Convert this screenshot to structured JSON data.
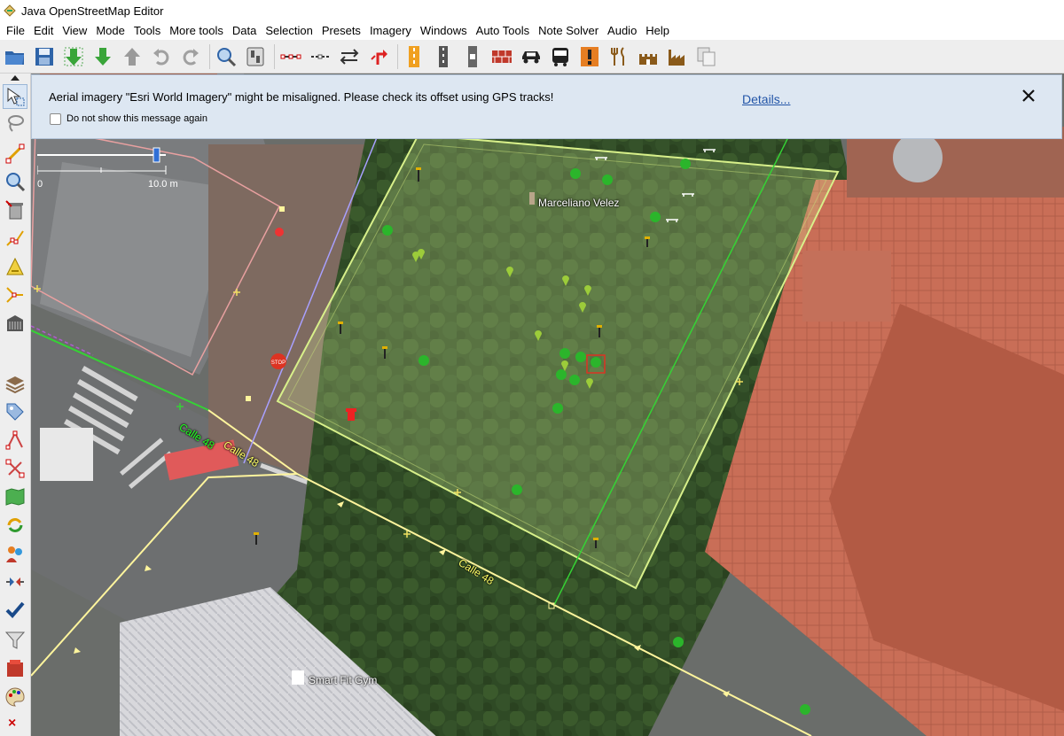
{
  "window": {
    "title": "Java OpenStreetMap Editor"
  },
  "menu": [
    "File",
    "Edit",
    "View",
    "Mode",
    "Tools",
    "More tools",
    "Data",
    "Selection",
    "Presets",
    "Imagery",
    "Windows",
    "Auto Tools",
    "Note Solver",
    "Audio",
    "Help"
  ],
  "toolbar": {
    "icons": [
      "open-file-icon",
      "save-icon",
      "download-icon",
      "download-along-icon",
      "upload-icon",
      "undo-icon",
      "redo-icon",
      "zoom-icon",
      "preferences-icon",
      "split-way-icon",
      "combine-way-icon",
      "reverse-way-icon",
      "turn-restriction-icon",
      "road-preset-icon",
      "track-preset-icon",
      "barrier-preset-icon",
      "wall-preset-icon",
      "car-preset-icon",
      "bus-preset-icon",
      "warning-preset-icon",
      "restaurant-preset-icon",
      "castle-preset-icon",
      "industry-preset-icon",
      "copy-icon"
    ]
  },
  "notification": {
    "message": "Aerial imagery \"Esri World Imagery\" might be misaligned. Please check its offset using GPS tracks!",
    "details_link": "Details...",
    "checkbox_label": "Do not show this message again",
    "checkbox_checked": false
  },
  "scale": {
    "start": "0",
    "end": "10.0 m"
  },
  "map": {
    "labels": {
      "monument": "Marceliano Velez",
      "street_1": "Calle 48",
      "street_2": "Calle 48",
      "street_3": "Calle 48",
      "gym": "Smart Fit Gym"
    }
  },
  "colors": {
    "notice_bg": "#dde7f2",
    "link": "#2255a8",
    "selected_area": "#d6f09a",
    "road": "#fff59d",
    "way_green": "#35d235"
  }
}
